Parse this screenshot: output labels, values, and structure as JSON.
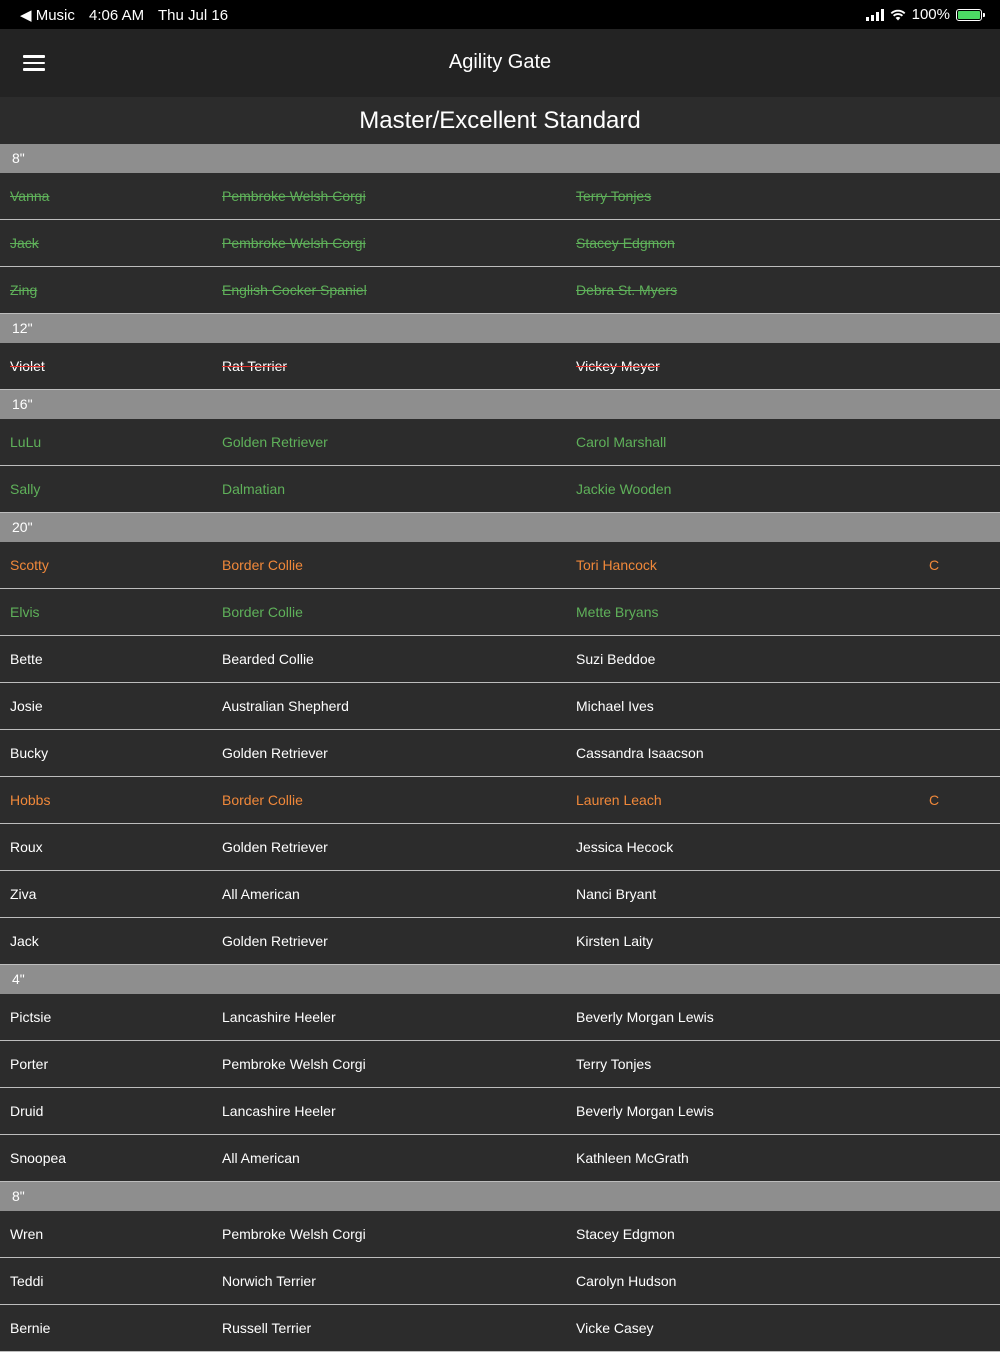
{
  "status_bar": {
    "back_app": "◀ Music",
    "time": "4:06 AM",
    "date": "Thu Jul 16",
    "battery": "100%"
  },
  "nav": {
    "title": "Agility Gate"
  },
  "page_title": "Master/Excellent Standard",
  "colors": {
    "header_bg": "#8e8e8e",
    "green": "#5fb15a",
    "orange": "#f0883a",
    "strike_red": "#e5322d"
  },
  "sections": [
    {
      "height": "8\"",
      "rows": [
        {
          "dog": "Vanna",
          "breed": "Pembroke Welsh Corgi",
          "handler": "Terry Tonjes",
          "flag": "",
          "style": "green-struck"
        },
        {
          "dog": "Jack",
          "breed": "Pembroke Welsh Corgi",
          "handler": "Stacey Edgmon",
          "flag": "",
          "style": "green-struck"
        },
        {
          "dog": "Zing",
          "breed": "English Cocker Spaniel",
          "handler": "Debra St. Myers",
          "flag": "",
          "style": "green-struck"
        }
      ]
    },
    {
      "height": "12\"",
      "rows": [
        {
          "dog": "Violet",
          "breed": "Rat Terrier",
          "handler": "Vickey Meyer",
          "flag": "",
          "style": "red-struck"
        }
      ]
    },
    {
      "height": "16\"",
      "rows": [
        {
          "dog": "LuLu",
          "breed": "Golden Retriever",
          "handler": "Carol Marshall",
          "flag": "",
          "style": "green"
        },
        {
          "dog": "Sally",
          "breed": "Dalmatian",
          "handler": "Jackie Wooden",
          "flag": "",
          "style": "green"
        }
      ]
    },
    {
      "height": "20\"",
      "rows": [
        {
          "dog": "Scotty",
          "breed": "Border Collie",
          "handler": "Tori Hancock",
          "flag": "C",
          "style": "orange"
        },
        {
          "dog": "Elvis",
          "breed": "Border Collie",
          "handler": "Mette Bryans",
          "flag": "",
          "style": "green"
        },
        {
          "dog": "Bette",
          "breed": "Bearded Collie",
          "handler": "Suzi Beddoe",
          "flag": "",
          "style": "white"
        },
        {
          "dog": "Josie",
          "breed": "Australian Shepherd",
          "handler": "Michael Ives",
          "flag": "",
          "style": "white"
        },
        {
          "dog": "Bucky",
          "breed": "Golden Retriever",
          "handler": "Cassandra Isaacson",
          "flag": "",
          "style": "white"
        },
        {
          "dog": "Hobbs",
          "breed": "Border Collie",
          "handler": "Lauren Leach",
          "flag": "C",
          "style": "orange"
        },
        {
          "dog": "Roux",
          "breed": "Golden Retriever",
          "handler": "Jessica Hecock",
          "flag": "",
          "style": "white"
        },
        {
          "dog": "Ziva",
          "breed": "All American",
          "handler": "Nanci Bryant",
          "flag": "",
          "style": "white"
        },
        {
          "dog": "Jack",
          "breed": "Golden Retriever",
          "handler": "Kirsten Laity",
          "flag": "",
          "style": "white"
        }
      ]
    },
    {
      "height": "4\"",
      "rows": [
        {
          "dog": "Pictsie",
          "breed": "Lancashire Heeler",
          "handler": "Beverly Morgan Lewis",
          "flag": "",
          "style": "white"
        },
        {
          "dog": "Porter",
          "breed": "Pembroke Welsh Corgi",
          "handler": "Terry Tonjes",
          "flag": "",
          "style": "white"
        },
        {
          "dog": "Druid",
          "breed": "Lancashire Heeler",
          "handler": "Beverly Morgan Lewis",
          "flag": "",
          "style": "white"
        },
        {
          "dog": "Snoopea",
          "breed": "All American",
          "handler": "Kathleen McGrath",
          "flag": "",
          "style": "white"
        }
      ]
    },
    {
      "height": "8\"",
      "rows": [
        {
          "dog": "Wren",
          "breed": "Pembroke Welsh Corgi",
          "handler": "Stacey Edgmon",
          "flag": "",
          "style": "white"
        },
        {
          "dog": "Teddi",
          "breed": "Norwich Terrier",
          "handler": "Carolyn Hudson",
          "flag": "",
          "style": "white"
        },
        {
          "dog": "Bernie",
          "breed": "Russell Terrier",
          "handler": "Vicke Casey",
          "flag": "",
          "style": "white"
        }
      ]
    }
  ]
}
